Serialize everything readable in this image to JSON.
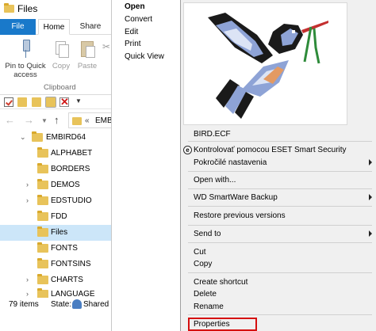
{
  "window": {
    "title": "Files"
  },
  "ribbon": {
    "tabs": [
      {
        "label": "File"
      },
      {
        "label": "Home"
      },
      {
        "label": "Share"
      }
    ],
    "buttons": {
      "pin_label_line1": "Pin to Quick",
      "pin_label_line2": "access",
      "copy_label": "Copy",
      "paste_label": "Paste"
    },
    "group_label": "Clipboard"
  },
  "address": {
    "path": "EMBIRD"
  },
  "tree": {
    "root": "EMBIRD64",
    "items": [
      "ALPHABET",
      "BORDERS",
      "DEMOS",
      "EDSTUDIO",
      "FDD",
      "Files",
      "FONTS",
      "FONTSINS",
      "CHARTS",
      "LANGUAGE"
    ],
    "selected": "Files"
  },
  "status": {
    "items": "79 items",
    "state": "State:",
    "shared": "Shared"
  },
  "preview_menu": {
    "items": [
      "Open",
      "Convert",
      "Edit",
      "Print",
      "Quick View"
    ]
  },
  "context_menu": {
    "filename": "BIRD.ECF",
    "eset_scan": "Kontrolovať pomocou ESET Smart Security",
    "eset_advanced": "Pokročilé nastavenia",
    "open_with": "Open with...",
    "wd_backup": "WD SmartWare Backup",
    "restore": "Restore previous versions",
    "send_to": "Send to",
    "cut": "Cut",
    "copy": "Copy",
    "create_shortcut": "Create shortcut",
    "delete": "Delete",
    "rename": "Rename",
    "properties": "Properties"
  },
  "colors": {
    "accent": "#1979ca",
    "selection": "#cce6f9",
    "highlight_border": "#d50f0f",
    "folder": "#e8c35a"
  },
  "icons": {
    "folder": "folder-icon",
    "eset": "eset-icon",
    "submenu": "chevron-right-icon"
  }
}
